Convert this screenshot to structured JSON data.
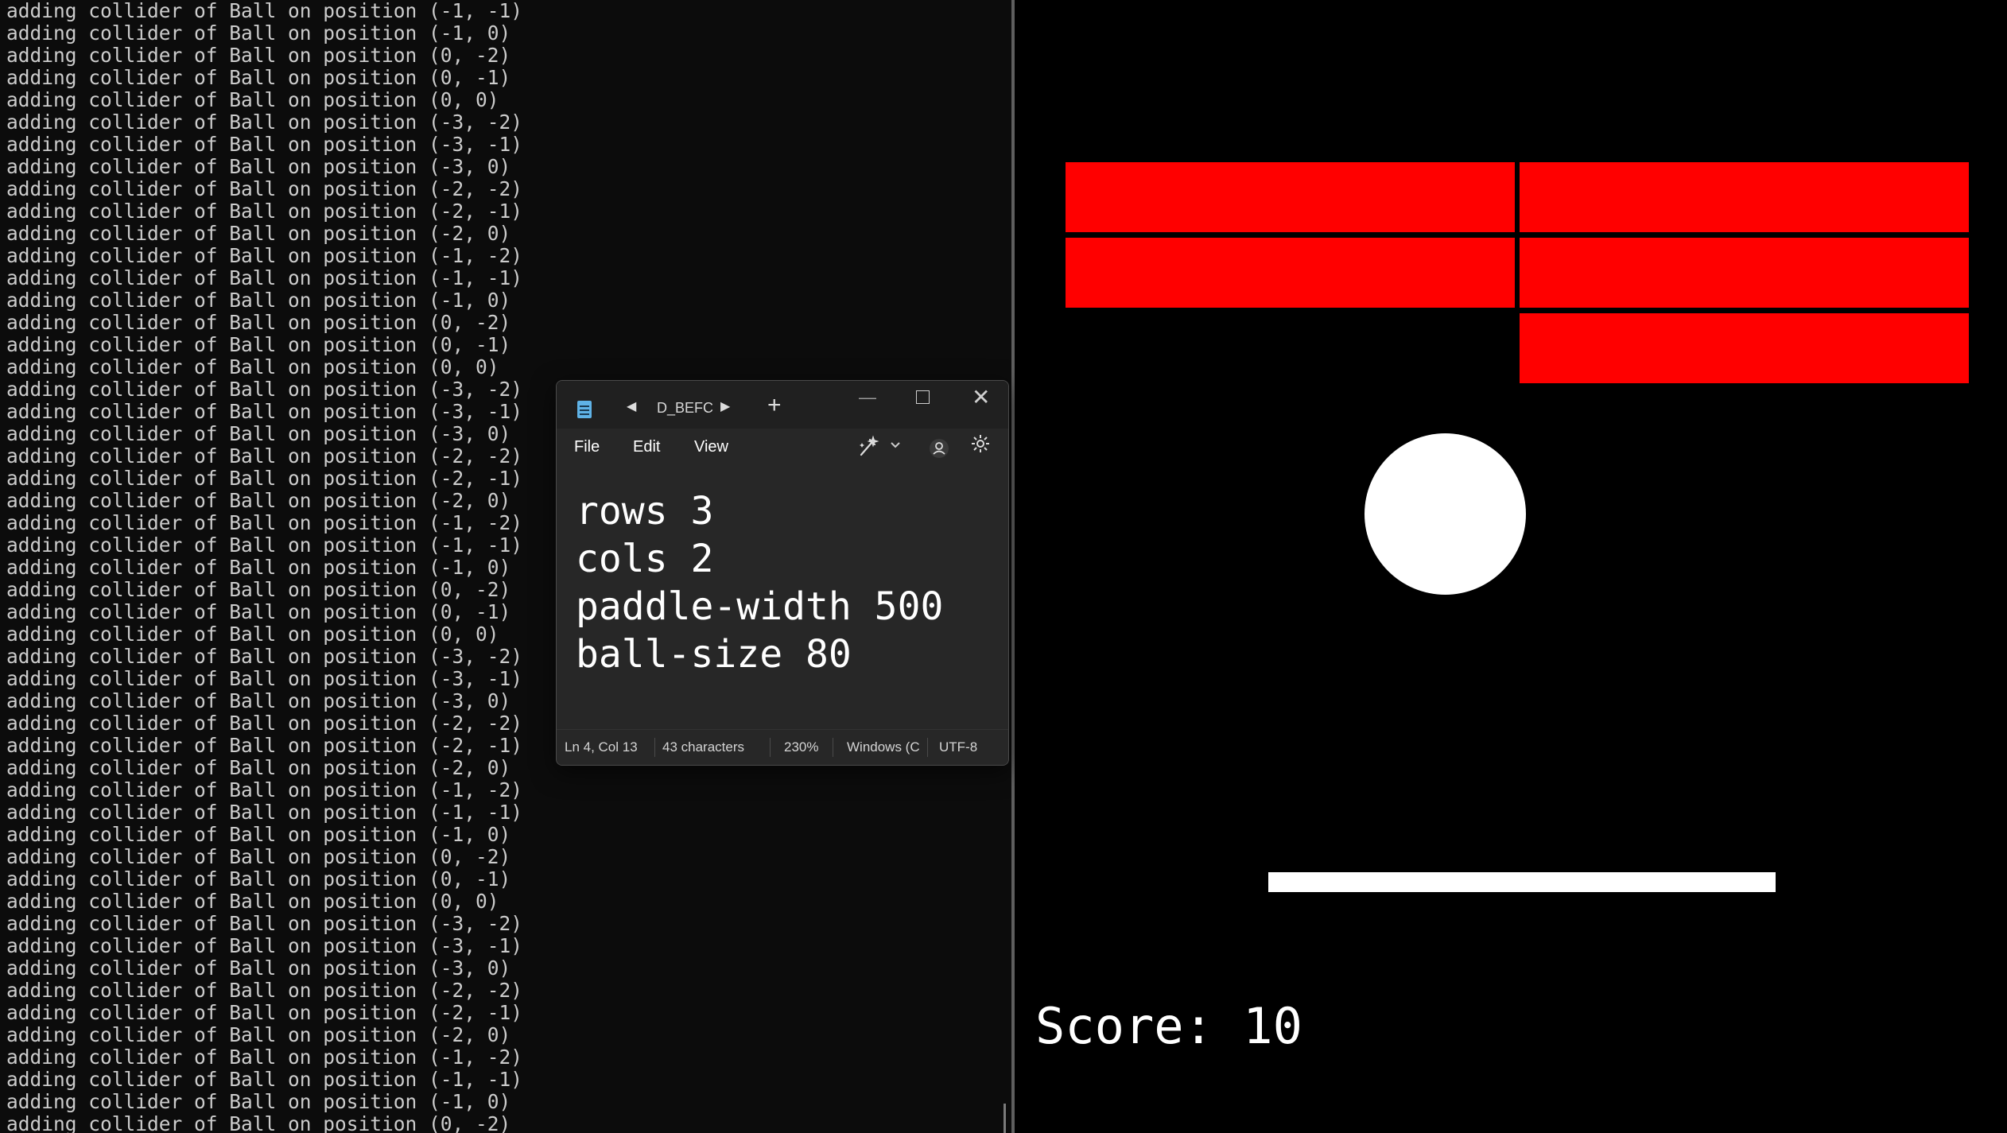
{
  "terminal": {
    "lines": [
      "adding collider of Ball on position (-1, -1)",
      "adding collider of Ball on position (-1, 0)",
      "adding collider of Ball on position (0, -2)",
      "adding collider of Ball on position (0, -1)",
      "adding collider of Ball on position (0, 0)",
      "adding collider of Ball on position (-3, -2)",
      "adding collider of Ball on position (-3, -1)",
      "adding collider of Ball on position (-3, 0)",
      "adding collider of Ball on position (-2, -2)",
      "adding collider of Ball on position (-2, -1)",
      "adding collider of Ball on position (-2, 0)",
      "adding collider of Ball on position (-1, -2)",
      "adding collider of Ball on position (-1, -1)",
      "adding collider of Ball on position (-1, 0)",
      "adding collider of Ball on position (0, -2)",
      "adding collider of Ball on position (0, -1)",
      "adding collider of Ball on position (0, 0)",
      "adding collider of Ball on position (-3, -2)",
      "adding collider of Ball on position (-3, -1)",
      "adding collider of Ball on position (-3, 0)",
      "adding collider of Ball on position (-2, -2)",
      "adding collider of Ball on position (-2, -1)",
      "adding collider of Ball on position (-2, 0)",
      "adding collider of Ball on position (-1, -2)",
      "adding collider of Ball on position (-1, -1)",
      "adding collider of Ball on position (-1, 0)",
      "adding collider of Ball on position (0, -2)",
      "adding collider of Ball on position (0, -1)",
      "adding collider of Ball on position (0, 0)",
      "adding collider of Ball on position (-3, -2)",
      "adding collider of Ball on position (-3, -1)",
      "adding collider of Ball on position (-3, 0)",
      "adding collider of Ball on position (-2, -2)",
      "adding collider of Ball on position (-2, -1)",
      "adding collider of Ball on position (-2, 0)",
      "adding collider of Ball on position (-1, -2)",
      "adding collider of Ball on position (-1, -1)",
      "adding collider of Ball on position (-1, 0)",
      "adding collider of Ball on position (0, -2)",
      "adding collider of Ball on position (0, -1)",
      "adding collider of Ball on position (0, 0)",
      "adding collider of Ball on position (-3, -2)",
      "adding collider of Ball on position (-3, -1)",
      "adding collider of Ball on position (-3, 0)",
      "adding collider of Ball on position (-2, -2)",
      "adding collider of Ball on position (-2, -1)",
      "adding collider of Ball on position (-2, 0)",
      "adding collider of Ball on position (-1, -2)",
      "adding collider of Ball on position (-1, -1)",
      "adding collider of Ball on position (-1, 0)",
      "adding collider of Ball on position (0, -2)"
    ]
  },
  "game": {
    "score_text": "Score: 10",
    "brick_color": "#ff0000",
    "ball_color": "#ffffff",
    "paddle_color": "#ffffff"
  },
  "notepad": {
    "app_icon": "notepad-icon",
    "tab_title": "D_BEFC",
    "prev_tab_glyph": "◀",
    "next_tab_glyph": "▶",
    "new_tab_glyph": "+",
    "minimize_glyph": "—",
    "close_glyph": "✕",
    "menu": {
      "file": "File",
      "edit": "Edit",
      "view": "View"
    },
    "copilot_icon": "copilot-icon",
    "account_icon": "account-icon",
    "settings_icon": "gear-icon",
    "content_lines": [
      "rows 3",
      "cols 2",
      "paddle-width 500",
      "ball-size 80"
    ],
    "status": {
      "position": "Ln 4, Col 13",
      "characters": "43 characters",
      "zoom": "230%",
      "line_ending": "Windows (C",
      "encoding": "UTF-8"
    }
  }
}
